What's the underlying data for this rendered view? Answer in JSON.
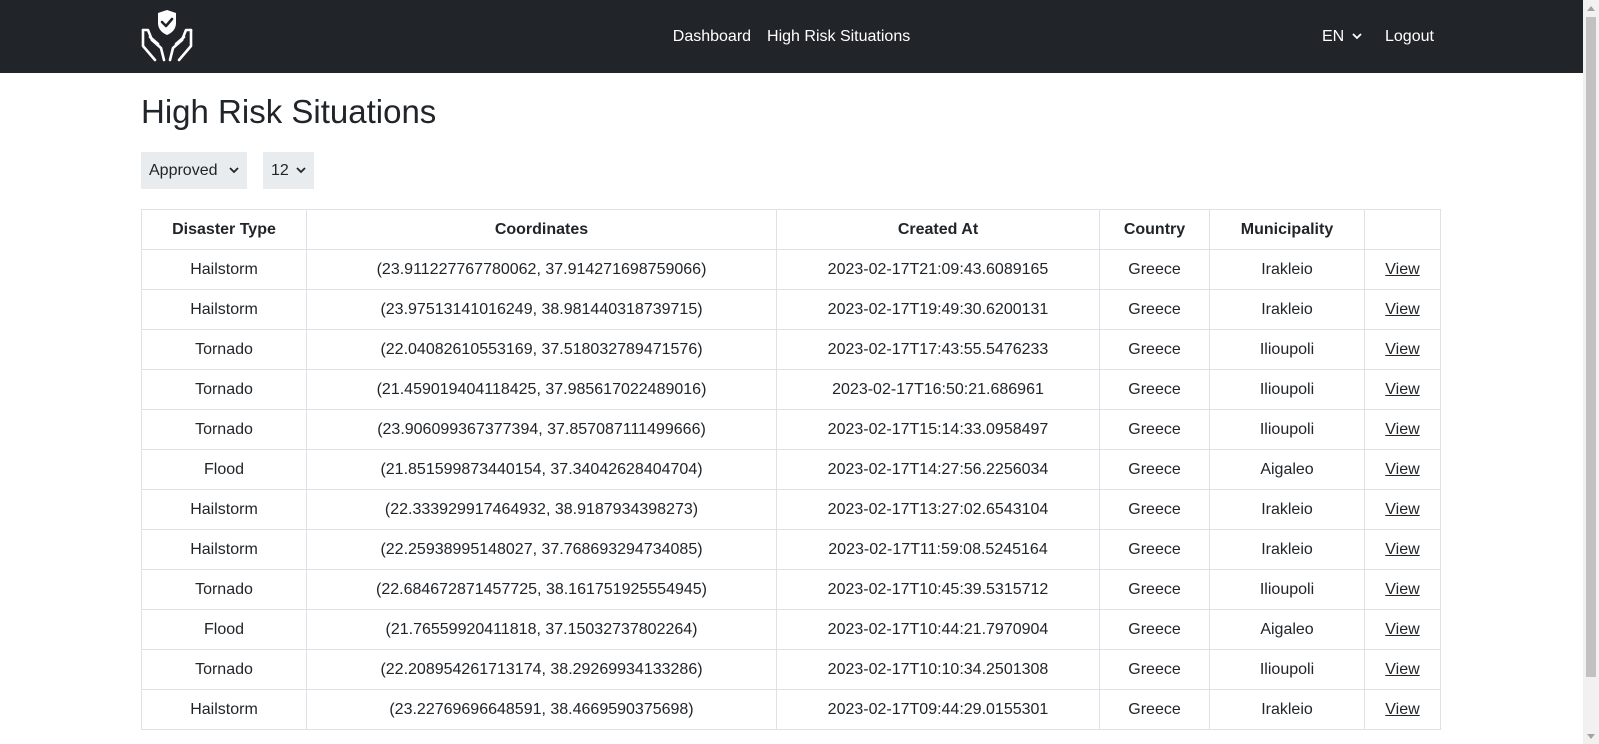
{
  "nav": {
    "logo_icon": "hands-shield-icon",
    "links": [
      "Dashboard",
      "High Risk Situations"
    ],
    "language": "EN",
    "logout": "Logout"
  },
  "page": {
    "title": "High Risk Situations"
  },
  "filters": {
    "status": "Approved",
    "page_size": "12"
  },
  "table": {
    "headers": [
      "Disaster Type",
      "Coordinates",
      "Created At",
      "Country",
      "Municipality",
      ""
    ],
    "rows": [
      [
        "Hailstorm",
        "(23.911227767780062, 37.914271698759066)",
        "2023-02-17T21:09:43.6089165",
        "Greece",
        "Irakleio",
        "View"
      ],
      [
        "Hailstorm",
        "(23.97513141016249, 38.981440318739715)",
        "2023-02-17T19:49:30.6200131",
        "Greece",
        "Irakleio",
        "View"
      ],
      [
        "Tornado",
        "(22.04082610553169, 37.518032789471576)",
        "2023-02-17T17:43:55.5476233",
        "Greece",
        "Ilioupoli",
        "View"
      ],
      [
        "Tornado",
        "(21.459019404118425, 37.985617022489016)",
        "2023-02-17T16:50:21.686961",
        "Greece",
        "Ilioupoli",
        "View"
      ],
      [
        "Tornado",
        "(23.906099367377394, 37.857087111499666)",
        "2023-02-17T15:14:33.0958497",
        "Greece",
        "Ilioupoli",
        "View"
      ],
      [
        "Flood",
        "(21.851599873440154, 37.34042628404704)",
        "2023-02-17T14:27:56.2256034",
        "Greece",
        "Aigaleo",
        "View"
      ],
      [
        "Hailstorm",
        "(22.333929917464932, 38.9187934398273)",
        "2023-02-17T13:27:02.6543104",
        "Greece",
        "Irakleio",
        "View"
      ],
      [
        "Hailstorm",
        "(22.25938995148027, 37.768693294734085)",
        "2023-02-17T11:59:08.5245164",
        "Greece",
        "Irakleio",
        "View"
      ],
      [
        "Tornado",
        "(22.684672871457725, 38.161751925554945)",
        "2023-02-17T10:45:39.5315712",
        "Greece",
        "Ilioupoli",
        "View"
      ],
      [
        "Flood",
        "(21.76559920411818, 37.15032737802264)",
        "2023-02-17T10:44:21.7970904",
        "Greece",
        "Aigaleo",
        "View"
      ],
      [
        "Tornado",
        "(22.208954261713174, 38.29269934133286)",
        "2023-02-17T10:10:34.2501308",
        "Greece",
        "Ilioupoli",
        "View"
      ],
      [
        "Hailstorm",
        "(23.22769696648591, 38.4669590375698)",
        "2023-02-17T09:44:29.0155301",
        "Greece",
        "Irakleio",
        "View"
      ]
    ]
  }
}
